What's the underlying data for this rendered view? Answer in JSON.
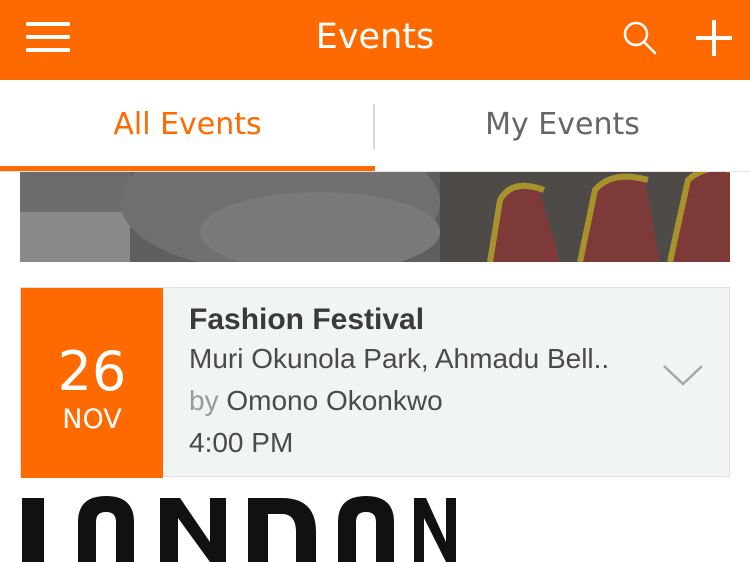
{
  "app": {
    "title": "Events"
  },
  "header": {
    "menu_icon": "hamburger-menu-icon",
    "search_icon": "search-icon",
    "add_icon": "plus-icon"
  },
  "tabs": [
    {
      "label": "All Events",
      "active": true
    },
    {
      "label": "My Events",
      "active": false
    }
  ],
  "event": {
    "day": "26",
    "month": "NOV",
    "title": "Fashion Festival",
    "location": "Muri Okunola Park, Ahmadu Bell..",
    "by_prefix": "by",
    "organizer": "Omono Okonkwo",
    "time": "4:00 PM",
    "expand_icon": "chevron-down-icon"
  },
  "banner": {
    "text": "LONDON"
  },
  "colors": {
    "accent": "#ff6a00",
    "card_bg": "#f0f4f3",
    "text_dark": "#3a3a3a",
    "text_muted": "#9a9a9a"
  }
}
